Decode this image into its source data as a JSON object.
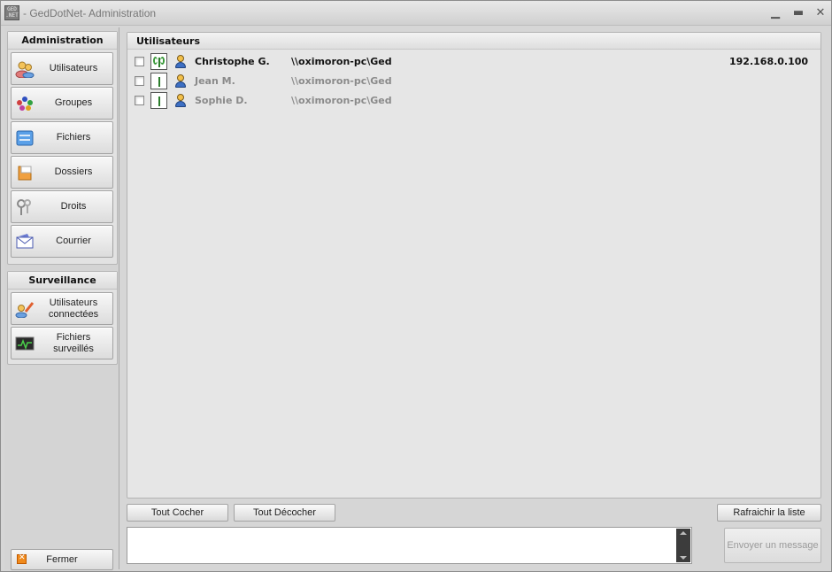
{
  "window": {
    "title": "- GedDotNet- Administration",
    "app_icon_text": "GED .NET",
    "minimize_glyph": "▁",
    "maximize_glyph": "▬",
    "close_glyph": "✕"
  },
  "sidebar": {
    "administration": {
      "title": "Administration",
      "items": [
        {
          "label": "Utilisateurs",
          "icon": "users-icon"
        },
        {
          "label": "Groupes",
          "icon": "groups-icon"
        },
        {
          "label": "Fichiers",
          "icon": "files-icon"
        },
        {
          "label": "Dossiers",
          "icon": "folders-icon"
        },
        {
          "label": "Droits",
          "icon": "keys-icon"
        },
        {
          "label": "Courrier",
          "icon": "mail-icon"
        }
      ]
    },
    "surveillance": {
      "title": "Surveillance",
      "items": [
        {
          "label": "Utilisateurs connectées",
          "icon": "connected-users-icon"
        },
        {
          "label": "Fichiers surveillés",
          "icon": "monitor-icon"
        }
      ]
    },
    "close_label": "Fermer"
  },
  "users_panel": {
    "title": "Utilisateurs",
    "users": [
      {
        "name": "Christophe G.",
        "path": "\\\\oximoron-pc\\Ged",
        "ip": "192.168.0.100",
        "connected": true
      },
      {
        "name": "Jean M.",
        "path": "\\\\oximoron-pc\\Ged",
        "ip": "",
        "connected": false
      },
      {
        "name": "Sophie D.",
        "path": "\\\\oximoron-pc\\Ged",
        "ip": "",
        "connected": false
      }
    ]
  },
  "actions": {
    "check_all": "Tout Cocher",
    "uncheck_all": "Tout Décocher",
    "refresh": "Rafraichir la liste",
    "send_message": "Envoyer un message",
    "message_value": ""
  }
}
